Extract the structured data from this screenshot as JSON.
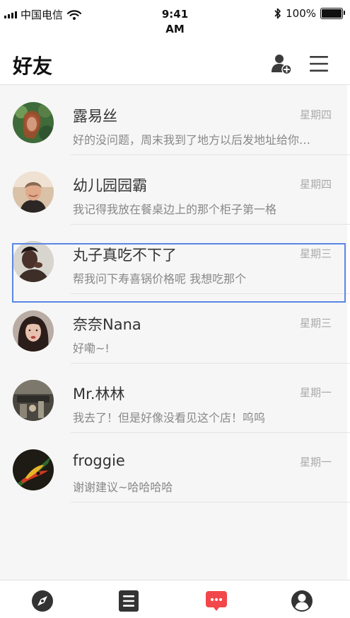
{
  "status_bar": {
    "carrier": "中国电信",
    "time_line1": "9:41",
    "time_line2": "AM",
    "battery": "100%"
  },
  "header": {
    "title": "好友",
    "add_icon": "add-friend-icon",
    "menu_icon": "menu-icon"
  },
  "contacts": [
    {
      "name": "露易丝",
      "time": "星期四",
      "message": "好的没问题，周末我到了地方以后发地址给你…"
    },
    {
      "name": "幼儿园园霸",
      "time": "星期四",
      "message": "我记得我放在餐桌边上的那个柜子第一格"
    },
    {
      "name": "丸子真吃不下了",
      "time": "星期三",
      "message": "帮我问下寿喜锅价格呢 我想吃那个"
    },
    {
      "name": "奈奈Nana",
      "time": "星期三",
      "message": "好嘞~!"
    },
    {
      "name": "Mr.林林",
      "time": "星期一",
      "message": "我去了！但是好像没看见这个店！呜呜"
    },
    {
      "name": "froggie",
      "time": "星期一",
      "message": "谢谢建议~哈哈哈哈"
    }
  ],
  "tabbar": {
    "tabs": [
      {
        "icon": "compass-icon",
        "active": false
      },
      {
        "icon": "document-icon",
        "active": false
      },
      {
        "icon": "chat-icon",
        "active": true
      },
      {
        "icon": "profile-icon",
        "active": false
      }
    ],
    "active_color": "#f2474a",
    "inactive_color": "#333333"
  }
}
